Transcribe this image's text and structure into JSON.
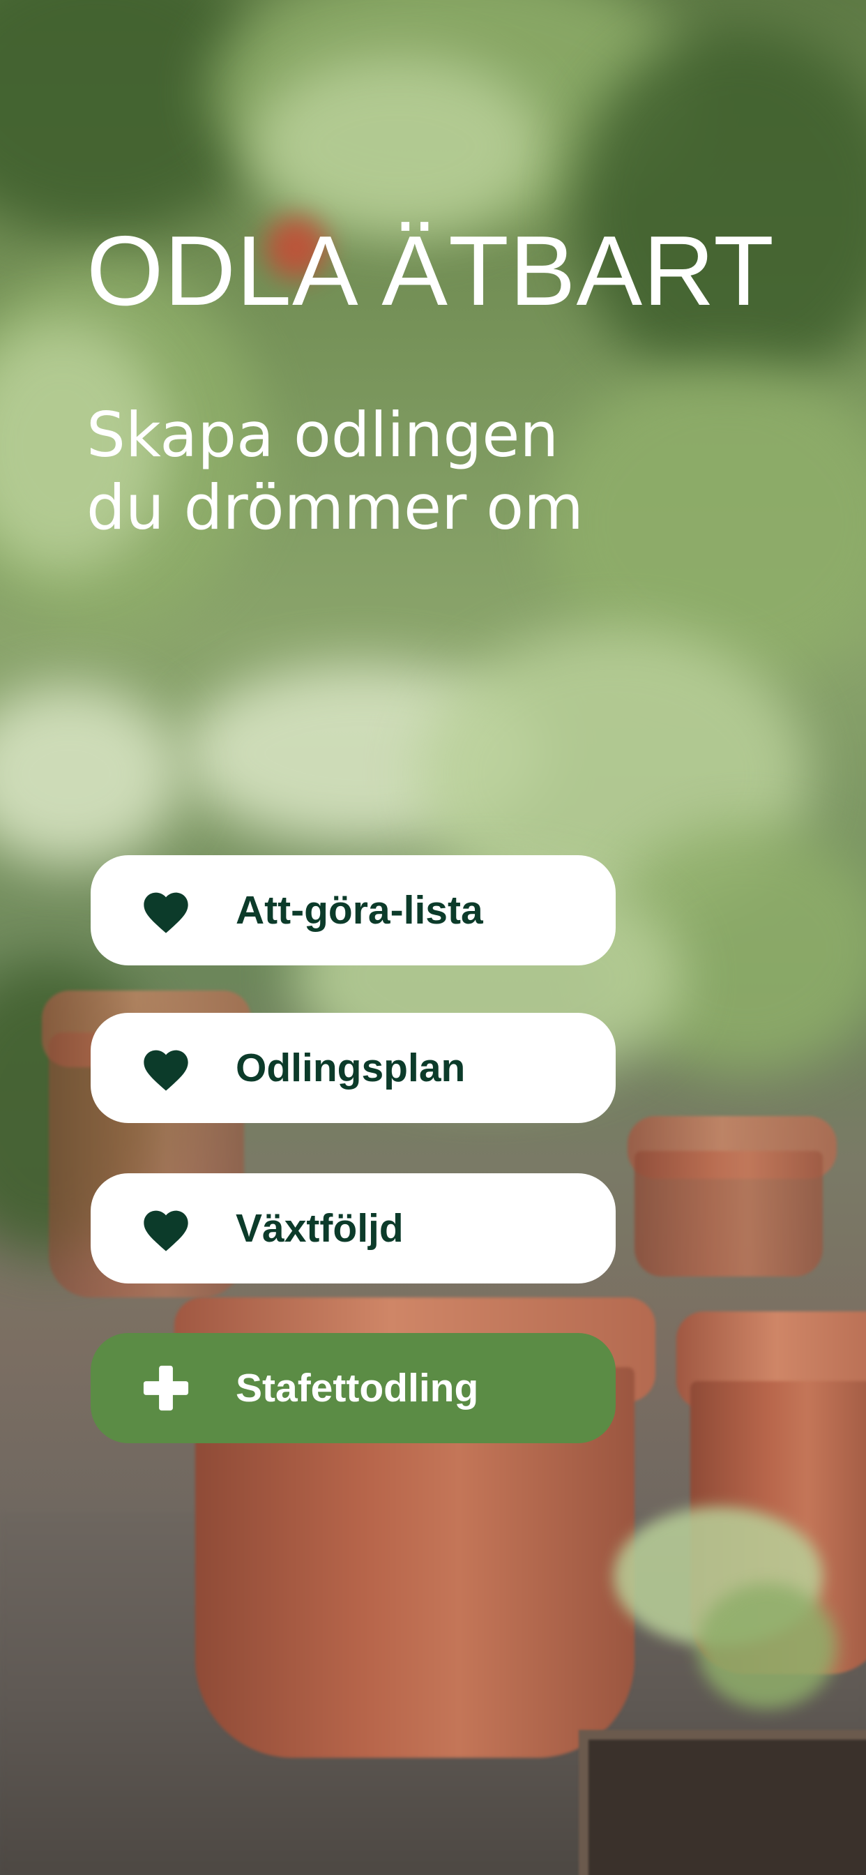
{
  "header": {
    "title": "ODLA ÄTBART",
    "subtitle_line1": "Skapa odlingen",
    "subtitle_line2": "du drömmer om"
  },
  "menu": {
    "items": [
      {
        "label": "Att-göra-lista",
        "icon": "heart-icon"
      },
      {
        "label": "Odlingsplan",
        "icon": "heart-icon"
      },
      {
        "label": "Växtföljd",
        "icon": "heart-icon"
      }
    ],
    "action": {
      "label": "Stafettodling",
      "icon": "plus-icon"
    }
  },
  "colors": {
    "primary_text": "#0c3b2a",
    "button_bg": "#ffffff",
    "accent_button": "#5b8c45",
    "heading_text": "#ffffff"
  }
}
